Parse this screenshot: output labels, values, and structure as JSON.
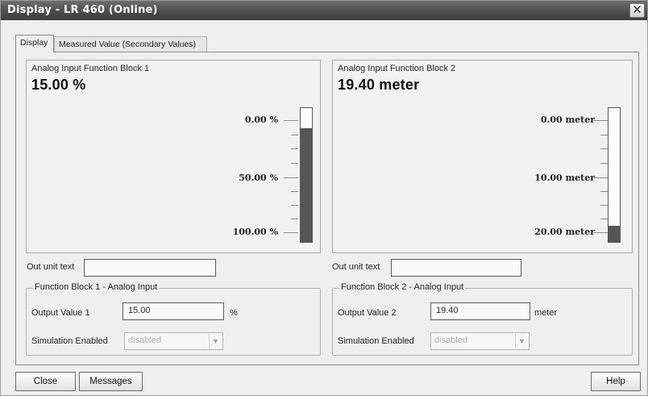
{
  "window": {
    "title": "Display - LR 460  (Online)"
  },
  "tabs": [
    {
      "label": "Display",
      "active": true
    },
    {
      "label": "Measured Value (Secondary Values)",
      "active": false
    }
  ],
  "blocks": [
    {
      "title": "Analog Input Function Block 1",
      "value": "15.00 %",
      "scale": [
        "0.00 %",
        "50.00 %",
        "100.00 %"
      ],
      "bar_fraction": 0.85,
      "out_unit_label": "Out unit text",
      "out_unit_value": "",
      "group_title": "Function Block 1 - Analog Input",
      "output_label": "Output Value 1",
      "output_value": "15.00",
      "output_unit": "%",
      "simulation_label": "Simulation Enabled",
      "simulation_value": "disabled"
    },
    {
      "title": "Analog Input Function Block 2",
      "value": "19.40 meter",
      "scale": [
        "0.00 meter",
        "10.00 meter",
        "20.00 meter"
      ],
      "bar_fraction": 0.12,
      "out_unit_label": "Out unit text",
      "out_unit_value": "",
      "group_title": "Function Block 2 - Analog Input",
      "output_label": "Output Value 2",
      "output_value": "19.40",
      "output_unit": "meter",
      "simulation_label": "Simulation Enabled",
      "simulation_value": "disabled"
    }
  ],
  "buttons": {
    "close": "Close",
    "messages": "Messages",
    "help": "Help"
  },
  "colors": {
    "titlebar": "#4a4a4a",
    "bar_fill": "#565656"
  }
}
